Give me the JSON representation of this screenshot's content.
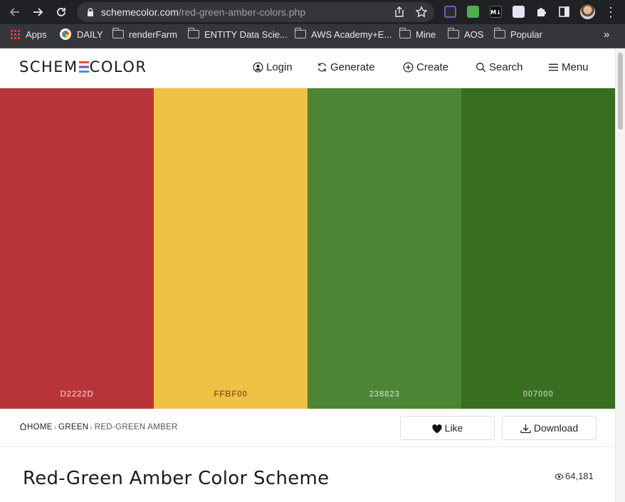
{
  "browser": {
    "url_host": "schemecolor.com",
    "url_path": "/red-green-amber-colors.php",
    "bookmarks": [
      {
        "label": "Apps"
      },
      {
        "label": "DAILY"
      },
      {
        "label": "renderFarm"
      },
      {
        "label": "ENTITY Data Scie..."
      },
      {
        "label": "AWS Academy+E..."
      },
      {
        "label": "Mine"
      },
      {
        "label": "AOS"
      },
      {
        "label": "Popular"
      }
    ],
    "more_bookmarks": "»",
    "extension_m4_label": "M↓"
  },
  "site": {
    "logo_left": "SCHEM",
    "logo_right": "COLOR",
    "nav": {
      "login": "Login",
      "generate": "Generate",
      "create": "Create",
      "search": "Search",
      "menu": "Menu"
    }
  },
  "palette": [
    {
      "code": "D2222D",
      "bg": "#b83438",
      "text_color": "#e8a0a2"
    },
    {
      "code": "FFBF00",
      "bg": "#efc145",
      "text_color": "#8c6d1c"
    },
    {
      "code": "238823",
      "bg": "#4c8634",
      "text_color": "#a8c79c"
    },
    {
      "code": "007000",
      "bg": "#386e20",
      "text_color": "#9dbd8f"
    }
  ],
  "breadcrumb": {
    "home": "HOME",
    "category": "GREEN",
    "current": "RED-GREEN AMBER"
  },
  "actions": {
    "like": "Like",
    "download": "Download"
  },
  "page": {
    "title": "Red-Green Amber Color Scheme",
    "views": "64,181"
  }
}
